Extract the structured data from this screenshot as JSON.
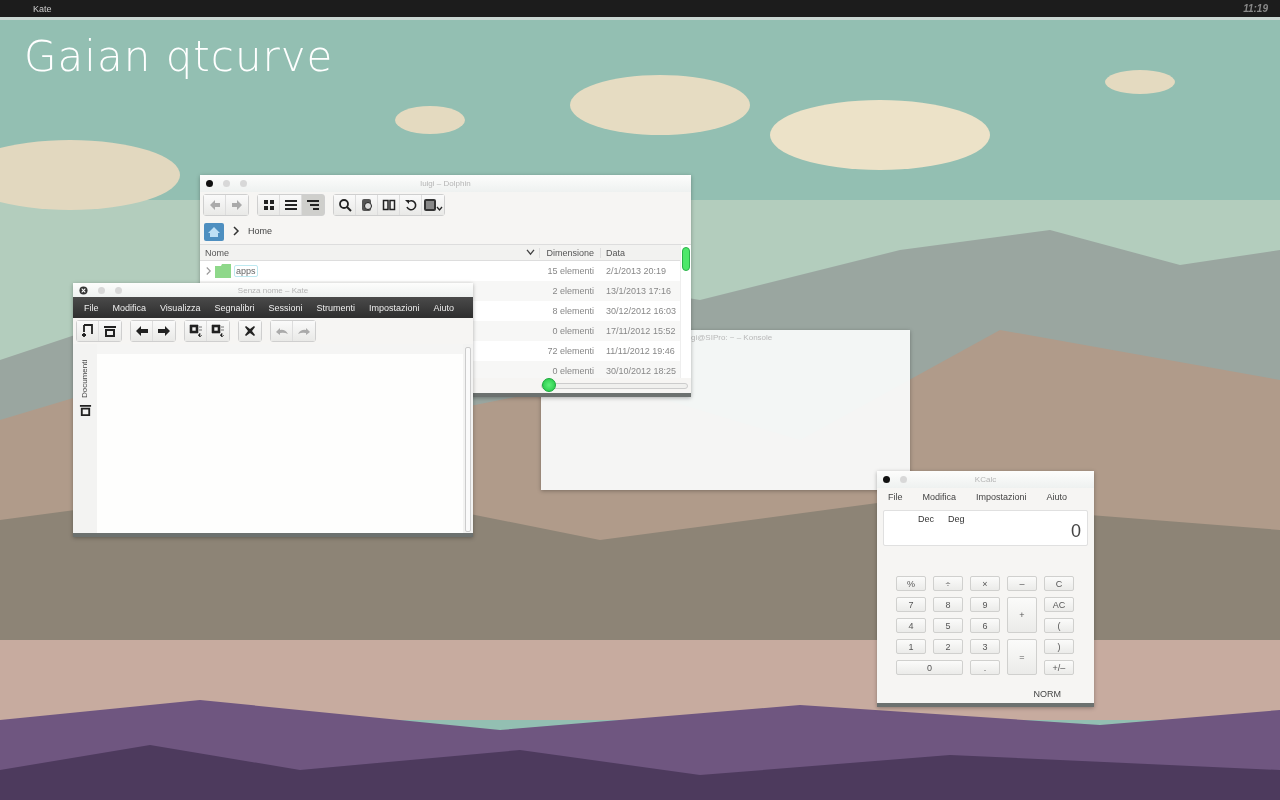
{
  "panel": {
    "task": "Kate",
    "clock": "11:19"
  },
  "desktop_title": "Gaian qtcurve",
  "dolphin": {
    "title": "luigi – Dolphin",
    "nav": [
      {
        "disabled": true
      },
      {
        "disabled": true
      }
    ],
    "view_modes": [
      {
        "selected": false
      },
      {
        "selected": false
      },
      {
        "selected": true
      }
    ],
    "breadcrumb": "Home",
    "columns": [
      "Nome",
      "Dimensione",
      "Data"
    ],
    "rows": [
      {
        "name": "apps",
        "size": "15 elementi",
        "date": "2/1/2013 20:19"
      },
      {
        "size": "2 elementi",
        "date": "13/1/2013 17:16"
      },
      {
        "size": "8 elementi",
        "date": "30/12/2012 16:03"
      },
      {
        "size": "0 elementi",
        "date": "17/11/2012 15:52"
      },
      {
        "size": "72 elementi",
        "date": "11/11/2012 19:46"
      },
      {
        "size": "0 elementi",
        "date": "30/10/2012 18:25"
      }
    ],
    "zoom": {
      "level": 0.05
    }
  },
  "konsole": {
    "title": "gi@SIPro: ~ – Konsole"
  },
  "kate": {
    "title": "Senza nome – Kate",
    "menu": [
      "File",
      "Modifica",
      "Visualizza",
      "Segnalibri",
      "Sessioni",
      "Strumenti",
      "Impostazioni",
      "Aiuto"
    ],
    "tools": [
      {
        "disabled": false
      },
      {
        "disabled": false
      },
      {
        "disabled": false
      },
      {
        "disabled": false
      },
      {
        "disabled": false
      },
      {
        "disabled": false
      },
      {
        "disabled": false
      },
      {
        "disabled": true
      },
      {
        "disabled": true
      }
    ],
    "side_tab": "Documenti"
  },
  "kcalc": {
    "title": "KCalc",
    "menu": [
      "File",
      "Modifica",
      "Impostazioni",
      "Aiuto"
    ],
    "display": {
      "base": "Dec",
      "angle": "Deg",
      "value": "0"
    },
    "keys": [
      {
        "label": "%",
        "kind": "key"
      },
      {
        "label": "÷",
        "kind": "key"
      },
      {
        "label": "×",
        "kind": "key"
      },
      {
        "label": "–",
        "kind": "key"
      },
      {
        "label": "C",
        "kind": "key"
      },
      {
        "label": "7",
        "kind": "key"
      },
      {
        "label": "8",
        "kind": "key"
      },
      {
        "label": "9",
        "kind": "key"
      },
      {
        "label": "+",
        "kind": "tall"
      },
      {
        "label": "AC",
        "kind": "key"
      },
      {
        "label": "4",
        "kind": "key"
      },
      {
        "label": "5",
        "kind": "key"
      },
      {
        "label": "6",
        "kind": "key"
      },
      {
        "label": "(",
        "kind": "key"
      },
      {
        "label": "1",
        "kind": "key"
      },
      {
        "label": "2",
        "kind": "key"
      },
      {
        "label": "3",
        "kind": "key"
      },
      {
        "label": "=",
        "kind": "tall"
      },
      {
        "label": ")",
        "kind": "key"
      },
      {
        "label": "0",
        "kind": "wide"
      },
      {
        "label": ".",
        "kind": "key"
      },
      {
        "label": "+/–",
        "kind": "key"
      }
    ],
    "status": "NORM"
  }
}
